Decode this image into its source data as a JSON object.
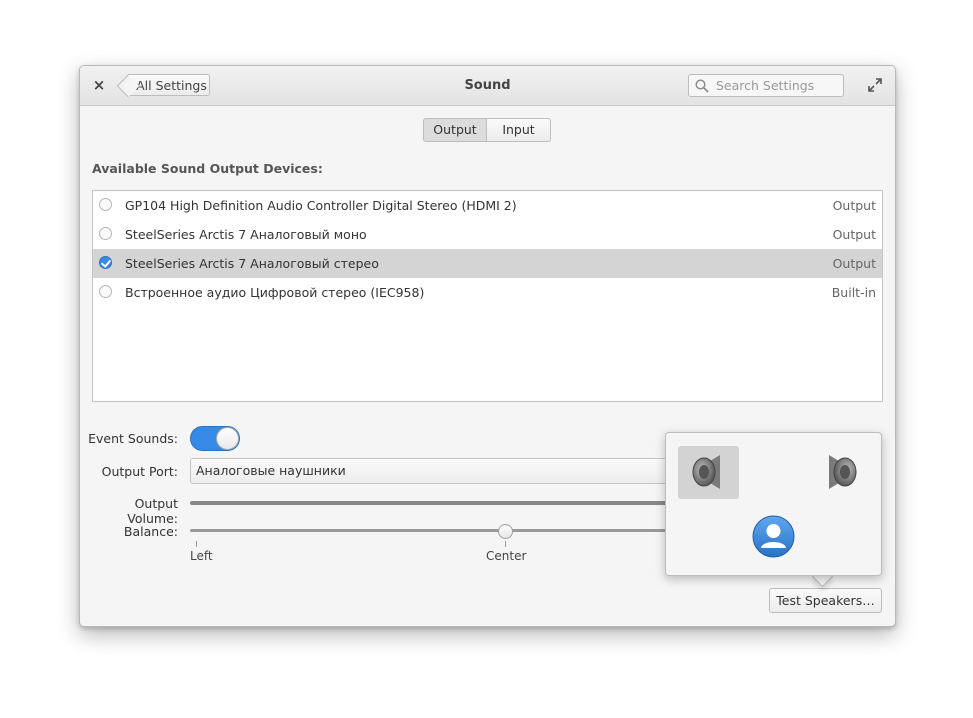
{
  "window": {
    "title": "Sound",
    "back_label": "All Settings",
    "search_placeholder": "Search Settings"
  },
  "tabs": [
    {
      "label": "Output",
      "active": true
    },
    {
      "label": "Input",
      "active": false
    }
  ],
  "devices_title": "Available Sound Output Devices:",
  "devices": [
    {
      "name": "GP104 High Definition Audio Controller Digital Stereo (HDMI 2)",
      "type": "Output",
      "selected": false
    },
    {
      "name": "SteelSeries Arctis 7 Аналоговый моно",
      "type": "Output",
      "selected": false
    },
    {
      "name": "SteelSeries Arctis 7 Аналоговый стерео",
      "type": "Output",
      "selected": true
    },
    {
      "name": "Встроенное аудио Цифровой стерео (IEC958)",
      "type": "Built-in",
      "selected": false
    }
  ],
  "settings": {
    "event_sounds_label": "Event Sounds:",
    "event_sounds_on": true,
    "output_port_label": "Output Port:",
    "output_port_value": "Аналоговые наушники",
    "output_volume_label": "Output Volume:",
    "balance_label": "Balance:",
    "balance_ticks": {
      "left": "Left",
      "center": "Center"
    },
    "balance_value": 0.5
  },
  "test_speakers_label": "Test Speakers…",
  "colors": {
    "accent": "#3689e6"
  }
}
